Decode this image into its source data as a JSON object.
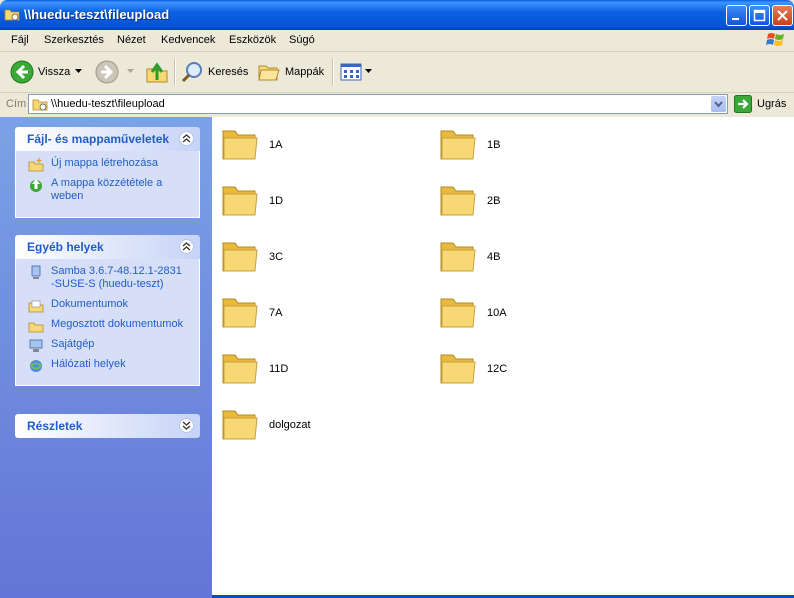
{
  "window": {
    "title": "\\\\huedu-teszt\\fileupload"
  },
  "menu": [
    "Fájl",
    "Szerkesztés",
    "Nézet",
    "Kedvencek",
    "Eszközök",
    "Súgó"
  ],
  "toolbar": {
    "back": "Vissza",
    "search": "Keresés",
    "folders": "Mappák"
  },
  "address": {
    "label": "Cím",
    "value": "\\\\huedu-teszt\\fileupload",
    "go": "Ugrás"
  },
  "panels": {
    "file_tasks": {
      "title": "Fájl- és mappaműveletek",
      "items": [
        "Új mappa létrehozása",
        "A mappa közzététele a weben"
      ]
    },
    "other_places": {
      "title": "Egyéb helyek",
      "items": [
        "Samba 3.6.7-48.12.1-2831-SUSE-S (huedu-teszt)",
        "Dokumentumok",
        "Megosztott dokumentumok",
        "Sajátgép",
        "Hálózati helyek"
      ]
    },
    "details": {
      "title": "Részletek"
    }
  },
  "folders": [
    "1A",
    "1B",
    "1D",
    "2B",
    "3C",
    "4B",
    "7A",
    "10A",
    "11D",
    "12C",
    "dolgozat"
  ],
  "colors": {
    "title_bar": "#0A5FE0",
    "task_link": "#215DC6",
    "sidebar": "#7BA2E7",
    "folder": "#F8D775"
  }
}
